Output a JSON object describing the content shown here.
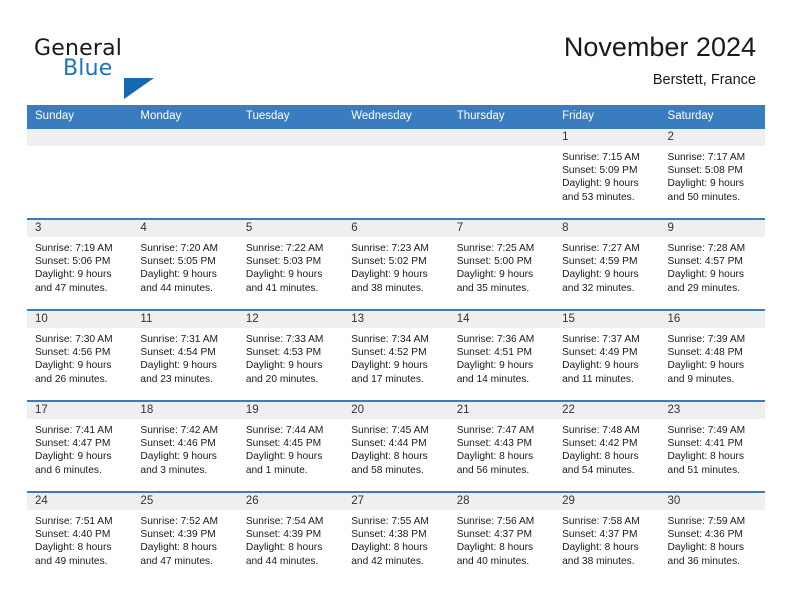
{
  "brand": {
    "name_part1": "General",
    "name_part2": "Blue"
  },
  "header": {
    "month_title": "November 2024",
    "location": "Berstett, France"
  },
  "colors": {
    "header_blue": "#3a7cc0",
    "brand_blue": "#1e73be",
    "daynum_background": "#efefef"
  },
  "weekday_headers": [
    "Sunday",
    "Monday",
    "Tuesday",
    "Wednesday",
    "Thursday",
    "Friday",
    "Saturday"
  ],
  "weeks": [
    [
      {
        "day": "",
        "blank": true,
        "sunrise": "",
        "sunset": "",
        "daylight1": "",
        "daylight2": ""
      },
      {
        "day": "",
        "blank": true,
        "sunrise": "",
        "sunset": "",
        "daylight1": "",
        "daylight2": ""
      },
      {
        "day": "",
        "blank": true,
        "sunrise": "",
        "sunset": "",
        "daylight1": "",
        "daylight2": ""
      },
      {
        "day": "",
        "blank": true,
        "sunrise": "",
        "sunset": "",
        "daylight1": "",
        "daylight2": ""
      },
      {
        "day": "",
        "blank": true,
        "sunrise": "",
        "sunset": "",
        "daylight1": "",
        "daylight2": ""
      },
      {
        "day": "1",
        "blank": false,
        "sunrise": "Sunrise: 7:15 AM",
        "sunset": "Sunset: 5:09 PM",
        "daylight1": "Daylight: 9 hours",
        "daylight2": "and 53 minutes."
      },
      {
        "day": "2",
        "blank": false,
        "sunrise": "Sunrise: 7:17 AM",
        "sunset": "Sunset: 5:08 PM",
        "daylight1": "Daylight: 9 hours",
        "daylight2": "and 50 minutes."
      }
    ],
    [
      {
        "day": "3",
        "blank": false,
        "sunrise": "Sunrise: 7:19 AM",
        "sunset": "Sunset: 5:06 PM",
        "daylight1": "Daylight: 9 hours",
        "daylight2": "and 47 minutes."
      },
      {
        "day": "4",
        "blank": false,
        "sunrise": "Sunrise: 7:20 AM",
        "sunset": "Sunset: 5:05 PM",
        "daylight1": "Daylight: 9 hours",
        "daylight2": "and 44 minutes."
      },
      {
        "day": "5",
        "blank": false,
        "sunrise": "Sunrise: 7:22 AM",
        "sunset": "Sunset: 5:03 PM",
        "daylight1": "Daylight: 9 hours",
        "daylight2": "and 41 minutes."
      },
      {
        "day": "6",
        "blank": false,
        "sunrise": "Sunrise: 7:23 AM",
        "sunset": "Sunset: 5:02 PM",
        "daylight1": "Daylight: 9 hours",
        "daylight2": "and 38 minutes."
      },
      {
        "day": "7",
        "blank": false,
        "sunrise": "Sunrise: 7:25 AM",
        "sunset": "Sunset: 5:00 PM",
        "daylight1": "Daylight: 9 hours",
        "daylight2": "and 35 minutes."
      },
      {
        "day": "8",
        "blank": false,
        "sunrise": "Sunrise: 7:27 AM",
        "sunset": "Sunset: 4:59 PM",
        "daylight1": "Daylight: 9 hours",
        "daylight2": "and 32 minutes."
      },
      {
        "day": "9",
        "blank": false,
        "sunrise": "Sunrise: 7:28 AM",
        "sunset": "Sunset: 4:57 PM",
        "daylight1": "Daylight: 9 hours",
        "daylight2": "and 29 minutes."
      }
    ],
    [
      {
        "day": "10",
        "blank": false,
        "sunrise": "Sunrise: 7:30 AM",
        "sunset": "Sunset: 4:56 PM",
        "daylight1": "Daylight: 9 hours",
        "daylight2": "and 26 minutes."
      },
      {
        "day": "11",
        "blank": false,
        "sunrise": "Sunrise: 7:31 AM",
        "sunset": "Sunset: 4:54 PM",
        "daylight1": "Daylight: 9 hours",
        "daylight2": "and 23 minutes."
      },
      {
        "day": "12",
        "blank": false,
        "sunrise": "Sunrise: 7:33 AM",
        "sunset": "Sunset: 4:53 PM",
        "daylight1": "Daylight: 9 hours",
        "daylight2": "and 20 minutes."
      },
      {
        "day": "13",
        "blank": false,
        "sunrise": "Sunrise: 7:34 AM",
        "sunset": "Sunset: 4:52 PM",
        "daylight1": "Daylight: 9 hours",
        "daylight2": "and 17 minutes."
      },
      {
        "day": "14",
        "blank": false,
        "sunrise": "Sunrise: 7:36 AM",
        "sunset": "Sunset: 4:51 PM",
        "daylight1": "Daylight: 9 hours",
        "daylight2": "and 14 minutes."
      },
      {
        "day": "15",
        "blank": false,
        "sunrise": "Sunrise: 7:37 AM",
        "sunset": "Sunset: 4:49 PM",
        "daylight1": "Daylight: 9 hours",
        "daylight2": "and 11 minutes."
      },
      {
        "day": "16",
        "blank": false,
        "sunrise": "Sunrise: 7:39 AM",
        "sunset": "Sunset: 4:48 PM",
        "daylight1": "Daylight: 9 hours",
        "daylight2": "and 9 minutes."
      }
    ],
    [
      {
        "day": "17",
        "blank": false,
        "sunrise": "Sunrise: 7:41 AM",
        "sunset": "Sunset: 4:47 PM",
        "daylight1": "Daylight: 9 hours",
        "daylight2": "and 6 minutes."
      },
      {
        "day": "18",
        "blank": false,
        "sunrise": "Sunrise: 7:42 AM",
        "sunset": "Sunset: 4:46 PM",
        "daylight1": "Daylight: 9 hours",
        "daylight2": "and 3 minutes."
      },
      {
        "day": "19",
        "blank": false,
        "sunrise": "Sunrise: 7:44 AM",
        "sunset": "Sunset: 4:45 PM",
        "daylight1": "Daylight: 9 hours",
        "daylight2": "and 1 minute."
      },
      {
        "day": "20",
        "blank": false,
        "sunrise": "Sunrise: 7:45 AM",
        "sunset": "Sunset: 4:44 PM",
        "daylight1": "Daylight: 8 hours",
        "daylight2": "and 58 minutes."
      },
      {
        "day": "21",
        "blank": false,
        "sunrise": "Sunrise: 7:47 AM",
        "sunset": "Sunset: 4:43 PM",
        "daylight1": "Daylight: 8 hours",
        "daylight2": "and 56 minutes."
      },
      {
        "day": "22",
        "blank": false,
        "sunrise": "Sunrise: 7:48 AM",
        "sunset": "Sunset: 4:42 PM",
        "daylight1": "Daylight: 8 hours",
        "daylight2": "and 54 minutes."
      },
      {
        "day": "23",
        "blank": false,
        "sunrise": "Sunrise: 7:49 AM",
        "sunset": "Sunset: 4:41 PM",
        "daylight1": "Daylight: 8 hours",
        "daylight2": "and 51 minutes."
      }
    ],
    [
      {
        "day": "24",
        "blank": false,
        "sunrise": "Sunrise: 7:51 AM",
        "sunset": "Sunset: 4:40 PM",
        "daylight1": "Daylight: 8 hours",
        "daylight2": "and 49 minutes."
      },
      {
        "day": "25",
        "blank": false,
        "sunrise": "Sunrise: 7:52 AM",
        "sunset": "Sunset: 4:39 PM",
        "daylight1": "Daylight: 8 hours",
        "daylight2": "and 47 minutes."
      },
      {
        "day": "26",
        "blank": false,
        "sunrise": "Sunrise: 7:54 AM",
        "sunset": "Sunset: 4:39 PM",
        "daylight1": "Daylight: 8 hours",
        "daylight2": "and 44 minutes."
      },
      {
        "day": "27",
        "blank": false,
        "sunrise": "Sunrise: 7:55 AM",
        "sunset": "Sunset: 4:38 PM",
        "daylight1": "Daylight: 8 hours",
        "daylight2": "and 42 minutes."
      },
      {
        "day": "28",
        "blank": false,
        "sunrise": "Sunrise: 7:56 AM",
        "sunset": "Sunset: 4:37 PM",
        "daylight1": "Daylight: 8 hours",
        "daylight2": "and 40 minutes."
      },
      {
        "day": "29",
        "blank": false,
        "sunrise": "Sunrise: 7:58 AM",
        "sunset": "Sunset: 4:37 PM",
        "daylight1": "Daylight: 8 hours",
        "daylight2": "and 38 minutes."
      },
      {
        "day": "30",
        "blank": false,
        "sunrise": "Sunrise: 7:59 AM",
        "sunset": "Sunset: 4:36 PM",
        "daylight1": "Daylight: 8 hours",
        "daylight2": "and 36 minutes."
      }
    ]
  ]
}
